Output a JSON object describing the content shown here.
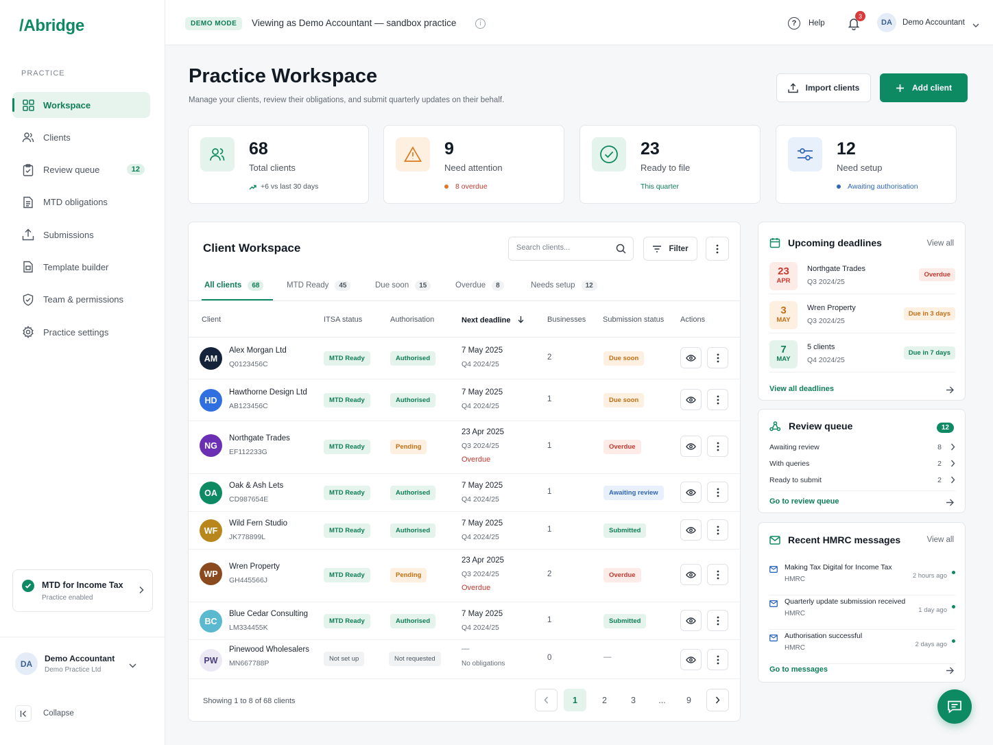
{
  "brand": {
    "logo_text": "/Abridge",
    "accent": "#0e8a62"
  },
  "sidebar": {
    "section_label": "PRACTICE",
    "items": [
      {
        "label": "Workspace",
        "icon": "grid-icon",
        "active": true
      },
      {
        "label": "Clients",
        "icon": "users-icon"
      },
      {
        "label": "Review queue",
        "icon": "clipboard-check-icon",
        "badge": "12"
      },
      {
        "label": "MTD obligations",
        "icon": "document-list-icon"
      },
      {
        "label": "Submissions",
        "icon": "upload-icon"
      },
      {
        "label": "Template builder",
        "icon": "template-icon"
      },
      {
        "label": "Team & permissions",
        "icon": "shield-icon"
      },
      {
        "label": "Practice settings",
        "icon": "gear-icon"
      }
    ],
    "mtd_card": {
      "title": "MTD for Income Tax",
      "subtitle": "Practice enabled"
    },
    "user": {
      "initials": "DA",
      "name": "Demo Accountant",
      "org": "Demo Practice Ltd"
    },
    "collapse_label": "Collapse"
  },
  "topbar": {
    "demo_pill": "DEMO MODE",
    "viewing_text": "Viewing as Demo Accountant — sandbox practice",
    "help_label": "Help",
    "notification_count": "3",
    "user_initials": "DA",
    "user_name": "Demo Accountant"
  },
  "header": {
    "title": "Practice Workspace",
    "subtitle": "Manage your clients, review their obligations, and submit quarterly updates on their behalf.",
    "import_label": "Import clients",
    "add_label": "Add client"
  },
  "stats": [
    {
      "value": "68",
      "label": "Total clients",
      "note": "+6 vs last 30 days",
      "note_color": "#4d5560",
      "icon": "users-icon",
      "icon_bg": "#e4f3ec",
      "icon_color": "#0e8a62"
    },
    {
      "value": "9",
      "label": "Need attention",
      "note": "8 overdue",
      "note_color": "#c6392f",
      "icon": "warning-icon",
      "icon_bg": "#fdf0e1",
      "icon_color": "#d97a1c"
    },
    {
      "value": "23",
      "label": "Ready to file",
      "note": "This quarter",
      "note_color": "#0e7d58",
      "icon": "check-circle-icon",
      "icon_bg": "#e4f3ec",
      "icon_color": "#0e8a62"
    },
    {
      "value": "12",
      "label": "Need setup",
      "note": "Awaiting authorisation",
      "note_color": "#3066b8",
      "icon": "sliders-icon",
      "icon_bg": "#e8f0fb",
      "icon_color": "#3066b8"
    }
  ],
  "workspace": {
    "title": "Client Workspace",
    "search_placeholder": "Search clients...",
    "filter_label": "Filter",
    "tabs": [
      {
        "label": "All clients",
        "count": "68",
        "active": true
      },
      {
        "label": "MTD Ready",
        "count": "45"
      },
      {
        "label": "Due soon",
        "count": "15"
      },
      {
        "label": "Overdue",
        "count": "8"
      },
      {
        "label": "Needs setup",
        "count": "12"
      }
    ],
    "columns": [
      "Client",
      "ITSA status",
      "Authorisation",
      "Next deadline",
      "Businesses",
      "Submission status",
      "Actions"
    ],
    "rows": [
      {
        "initials": "AM",
        "avatar_color": "#14233a",
        "name": "Alex Morgan Ltd",
        "utr": "Q0123456C",
        "itsa": "MTD Ready",
        "auth": "Authorised",
        "deadline": "7 May 2025",
        "quarter": "Q4 2024/25",
        "overdue": "",
        "businesses": "2",
        "submission": "Due soon"
      },
      {
        "initials": "HD",
        "avatar_color": "#2f6fe0",
        "name": "Hawthorne Design Ltd",
        "utr": "AB123456C",
        "itsa": "MTD Ready",
        "auth": "Authorised",
        "deadline": "7 May 2025",
        "quarter": "Q4 2024/25",
        "overdue": "",
        "businesses": "1",
        "submission": "Due soon"
      },
      {
        "initials": "NG",
        "avatar_color": "#6a2fb3",
        "name": "Northgate Trades",
        "utr": "EF112233G",
        "itsa": "MTD Ready",
        "auth": "Pending",
        "deadline": "23 Apr 2025",
        "quarter": "Q3 2024/25",
        "overdue": "Overdue",
        "businesses": "1",
        "submission": "Overdue"
      },
      {
        "initials": "OA",
        "avatar_color": "#0e8a62",
        "name": "Oak & Ash Lets",
        "utr": "CD987654E",
        "itsa": "MTD Ready",
        "auth": "Authorised",
        "deadline": "7 May 2025",
        "quarter": "Q4 2024/25",
        "overdue": "",
        "businesses": "1",
        "submission": "Awaiting review"
      },
      {
        "initials": "WF",
        "avatar_color": "#b8861a",
        "name": "Wild Fern Studio",
        "utr": "JK778899L",
        "itsa": "MTD Ready",
        "auth": "Authorised",
        "deadline": "7 May 2025",
        "quarter": "Q4 2024/25",
        "overdue": "",
        "businesses": "1",
        "submission": "Submitted"
      },
      {
        "initials": "WP",
        "avatar_color": "#8a4a1e",
        "name": "Wren Property",
        "utr": "GH445566J",
        "itsa": "MTD Ready",
        "auth": "Pending",
        "deadline": "23 Apr 2025",
        "quarter": "Q3 2024/25",
        "overdue": "Overdue",
        "businesses": "2",
        "submission": "Overdue"
      },
      {
        "initials": "BC",
        "avatar_color": "#5ab8cf",
        "name": "Blue Cedar Consulting",
        "utr": "LM334455K",
        "itsa": "MTD Ready",
        "auth": "Authorised",
        "deadline": "7 May 2025",
        "quarter": "Q4 2024/25",
        "overdue": "",
        "businesses": "1",
        "submission": "Submitted"
      },
      {
        "initials": "PW",
        "avatar_color": "#ece9f4",
        "name": "Pinewood Wholesalers",
        "utr": "MN667788P",
        "itsa": "Not set up",
        "auth": "Not requested",
        "deadline": "—",
        "quarter": "No obligations",
        "overdue": "",
        "businesses": "0",
        "submission": "—"
      }
    ],
    "showing": "Showing 1 to 8 of 68 clients",
    "pages": [
      "1",
      "2",
      "3",
      "...",
      "9"
    ]
  },
  "deadlines": {
    "title": "Upcoming deadlines",
    "view_all": "View all",
    "items": [
      {
        "day": "23",
        "month": "APR",
        "name": "Northgate Trades",
        "quarter": "Q3 2024/25",
        "status": "Overdue",
        "kind": "red"
      },
      {
        "day": "3",
        "month": "MAY",
        "name": "Wren Property",
        "quarter": "Q3 2024/25",
        "status": "Due in 3 days",
        "kind": "amber"
      },
      {
        "day": "7",
        "month": "MAY",
        "name": "5 clients",
        "quarter": "Q4 2024/25",
        "status": "Due in 7 days",
        "kind": "green"
      }
    ],
    "link": "View all deadlines"
  },
  "review_queue": {
    "title": "Review queue",
    "badge": "12",
    "items": [
      {
        "label": "Awaiting review",
        "count": "8"
      },
      {
        "label": "With queries",
        "count": "2"
      },
      {
        "label": "Ready to submit",
        "count": "2"
      }
    ],
    "link": "Go to review queue"
  },
  "messages": {
    "title": "Recent HMRC messages",
    "view_all": "View all",
    "items": [
      {
        "title": "Making Tax Digital for Income Tax",
        "sender": "HMRC",
        "time": "2 hours ago"
      },
      {
        "title": "Quarterly update submission received",
        "sender": "HMRC",
        "time": "1 day ago"
      },
      {
        "title": "Authorisation successful",
        "sender": "HMRC",
        "time": "2 days ago"
      }
    ],
    "link": "Go to messages"
  }
}
